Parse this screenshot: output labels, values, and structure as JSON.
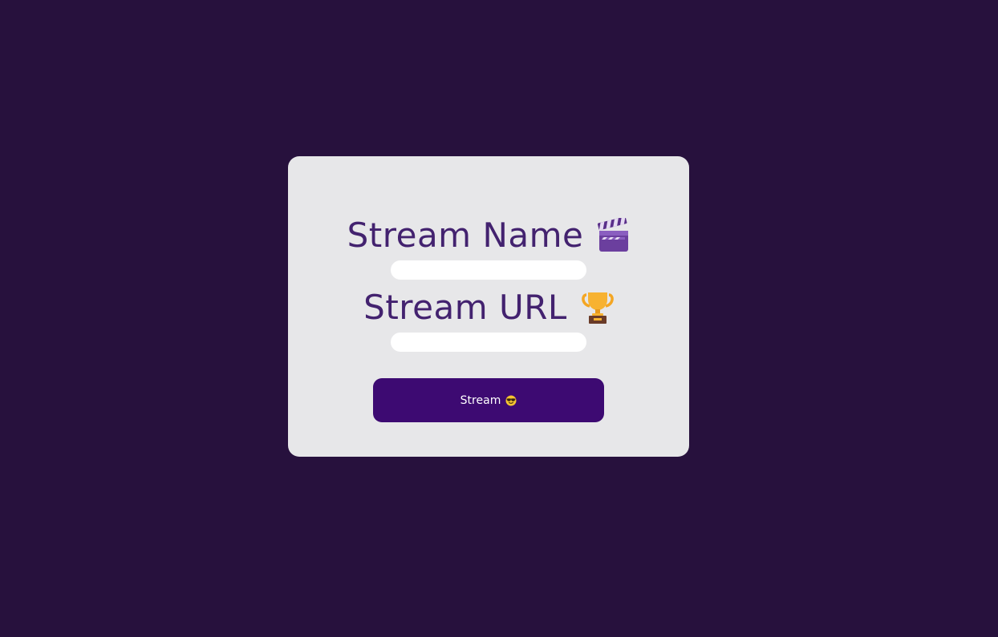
{
  "form": {
    "stream_name_label": "Stream Name",
    "stream_name_value": "",
    "stream_url_label": "Stream URL",
    "stream_url_value": "",
    "submit_label": "Stream"
  },
  "icons": {
    "stream_name": "clapper-board-icon",
    "stream_url": "trophy-icon",
    "submit": "smiling-face-with-sunglasses-icon"
  },
  "colors": {
    "background": "#27113d",
    "card": "#e7e7e9",
    "label_text": "#43226f",
    "button": "#3d0a72",
    "button_text": "#ffffff",
    "input": "#ffffff"
  }
}
